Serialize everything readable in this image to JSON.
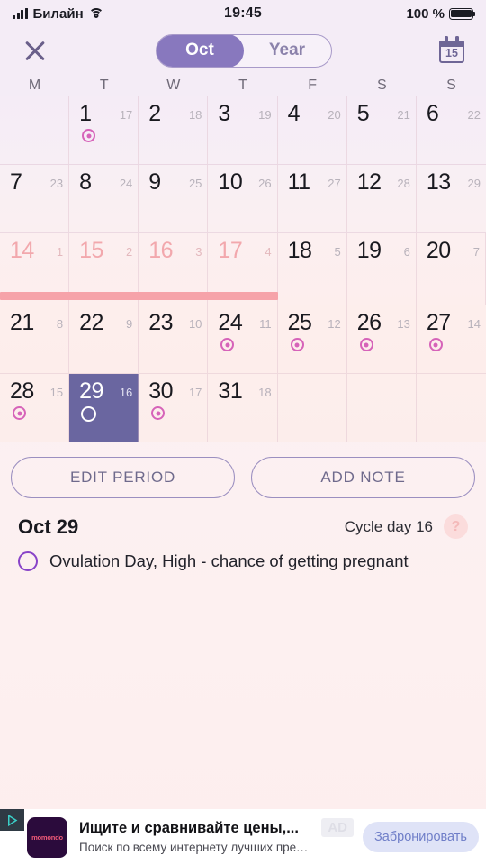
{
  "status_bar": {
    "carrier": "Билайн",
    "time": "19:45",
    "battery_percent": "100 %",
    "signal_icon": "signal-bars-icon",
    "wifi_icon": "wifi-icon",
    "battery_icon": "battery-full-icon"
  },
  "nav": {
    "close_icon": "close-icon",
    "toggle": {
      "month_label": "Oct",
      "year_label": "Year",
      "active": "Oct"
    },
    "calendar_icon_day": "15"
  },
  "calendar": {
    "weekdays": [
      "M",
      "T",
      "W",
      "T",
      "F",
      "S",
      "S"
    ],
    "weeks": [
      [
        {
          "day": "",
          "cycle": "",
          "marker": "none",
          "state": "empty"
        },
        {
          "day": "1",
          "cycle": "17",
          "marker": "fertility",
          "state": "normal"
        },
        {
          "day": "2",
          "cycle": "18",
          "marker": "none",
          "state": "normal"
        },
        {
          "day": "3",
          "cycle": "19",
          "marker": "none",
          "state": "normal"
        },
        {
          "day": "4",
          "cycle": "20",
          "marker": "none",
          "state": "normal"
        },
        {
          "day": "5",
          "cycle": "21",
          "marker": "none",
          "state": "normal"
        },
        {
          "day": "6",
          "cycle": "22",
          "marker": "none",
          "state": "normal"
        }
      ],
      [
        {
          "day": "7",
          "cycle": "23",
          "marker": "none",
          "state": "normal"
        },
        {
          "day": "8",
          "cycle": "24",
          "marker": "none",
          "state": "normal"
        },
        {
          "day": "9",
          "cycle": "25",
          "marker": "none",
          "state": "normal"
        },
        {
          "day": "10",
          "cycle": "26",
          "marker": "none",
          "state": "normal"
        },
        {
          "day": "11",
          "cycle": "27",
          "marker": "none",
          "state": "normal"
        },
        {
          "day": "12",
          "cycle": "28",
          "marker": "none",
          "state": "normal"
        },
        {
          "day": "13",
          "cycle": "29",
          "marker": "none",
          "state": "normal"
        }
      ],
      [
        {
          "day": "14",
          "cycle": "1",
          "marker": "none",
          "state": "period"
        },
        {
          "day": "15",
          "cycle": "2",
          "marker": "none",
          "state": "period"
        },
        {
          "day": "16",
          "cycle": "3",
          "marker": "none",
          "state": "period"
        },
        {
          "day": "17",
          "cycle": "4",
          "marker": "none",
          "state": "period"
        },
        {
          "day": "18",
          "cycle": "5",
          "marker": "none",
          "state": "normal"
        },
        {
          "day": "19",
          "cycle": "6",
          "marker": "none",
          "state": "normal"
        },
        {
          "day": "20",
          "cycle": "7",
          "marker": "none",
          "state": "normal"
        }
      ],
      [
        {
          "day": "21",
          "cycle": "8",
          "marker": "none",
          "state": "normal"
        },
        {
          "day": "22",
          "cycle": "9",
          "marker": "none",
          "state": "normal"
        },
        {
          "day": "23",
          "cycle": "10",
          "marker": "none",
          "state": "normal"
        },
        {
          "day": "24",
          "cycle": "11",
          "marker": "fertility",
          "state": "normal"
        },
        {
          "day": "25",
          "cycle": "12",
          "marker": "fertility",
          "state": "normal"
        },
        {
          "day": "26",
          "cycle": "13",
          "marker": "fertility",
          "state": "normal"
        },
        {
          "day": "27",
          "cycle": "14",
          "marker": "fertility",
          "state": "normal"
        }
      ],
      [
        {
          "day": "28",
          "cycle": "15",
          "marker": "fertility",
          "state": "normal"
        },
        {
          "day": "29",
          "cycle": "16",
          "marker": "ovulation",
          "state": "selected"
        },
        {
          "day": "30",
          "cycle": "17",
          "marker": "fertility",
          "state": "normal"
        },
        {
          "day": "31",
          "cycle": "18",
          "marker": "none",
          "state": "normal"
        },
        {
          "day": "",
          "cycle": "",
          "marker": "none",
          "state": "empty"
        },
        {
          "day": "",
          "cycle": "",
          "marker": "none",
          "state": "empty"
        },
        {
          "day": "",
          "cycle": "",
          "marker": "none",
          "state": "empty"
        }
      ]
    ],
    "period_bar": {
      "start_column": 0,
      "span_columns": 4,
      "color": "#f6a3a9"
    }
  },
  "actions": {
    "edit_period_label": "EDIT PERIOD",
    "add_note_label": "ADD NOTE"
  },
  "info": {
    "date": "Oct 29",
    "cycle_day": "Cycle day 16",
    "help_label": "?",
    "ovulation_text": "Ovulation Day, High - chance of getting pregnant",
    "ovulation_marker_color": "#8843c8"
  },
  "ad": {
    "logo_text": "momondo",
    "title": "Ищите и сравнивайте цены,...",
    "subtitle": "Поиск по всему интернету лучших предложений...",
    "badge": "AD",
    "cta_label": "Забронировать",
    "adchoices_icon": "adchoices-icon"
  },
  "colors": {
    "accent_purple": "#8878be",
    "selected_purple": "#6a66a0",
    "period_pink": "#f6a3a9",
    "fertility_magenta": "#d663b9",
    "ovulation_purple": "#8843c8"
  }
}
